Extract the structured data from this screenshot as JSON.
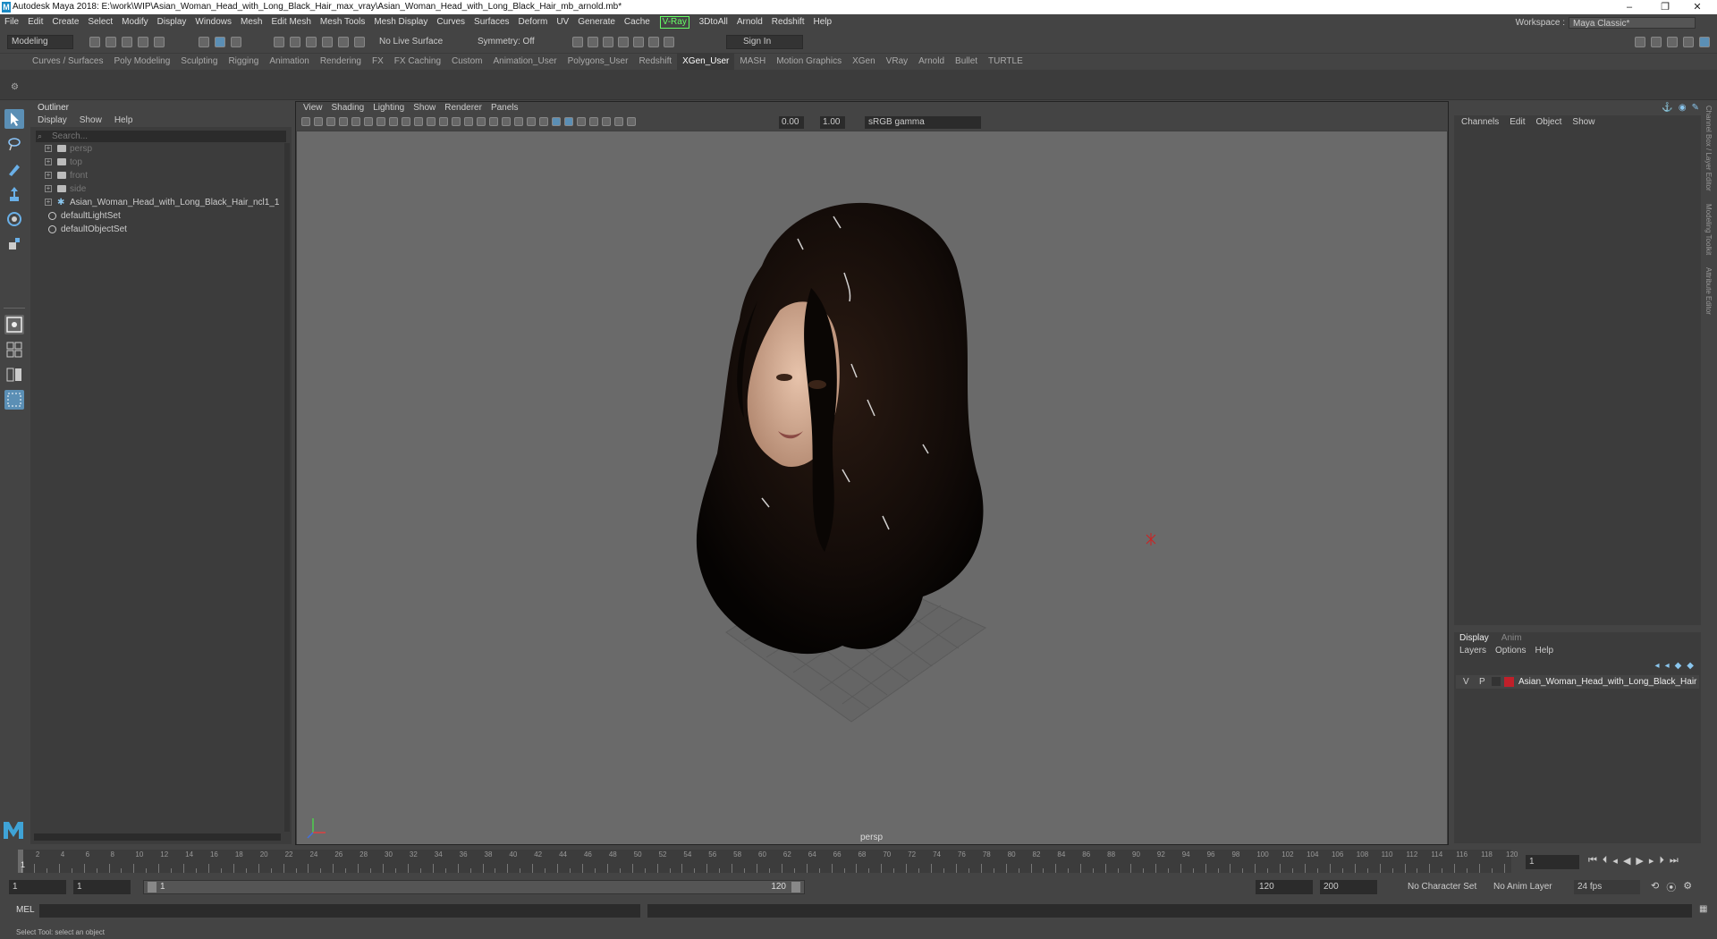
{
  "title": "Autodesk Maya 2018: E:\\work\\WIP\\Asian_Woman_Head_with_Long_Black_Hair_max_vray\\Asian_Woman_Head_with_Long_Black_Hair_mb_arnold.mb*",
  "logo_letter": "M",
  "menus": [
    "File",
    "Edit",
    "Create",
    "Select",
    "Modify",
    "Display",
    "Windows",
    "Mesh",
    "Edit Mesh",
    "Mesh Tools",
    "Mesh Display",
    "Curves",
    "Surfaces",
    "Deform",
    "UV",
    "Generate",
    "Cache"
  ],
  "vray_menu": "V-Ray",
  "menus_after": [
    "3DtoAll",
    "Arnold",
    "Redshift",
    "Help"
  ],
  "workspace": {
    "label": "Workspace :",
    "value": "Maya Classic*"
  },
  "status": {
    "mode": "Modeling",
    "live_surface": "No Live Surface",
    "symmetry": "Symmetry: Off",
    "sign_in": "Sign In"
  },
  "shelf_tabs": [
    "Curves / Surfaces",
    "Poly Modeling",
    "Sculpting",
    "Rigging",
    "Animation",
    "Rendering",
    "FX",
    "FX Caching",
    "Custom",
    "Animation_User",
    "Polygons_User",
    "Redshift",
    "XGen_User",
    "MASH",
    "Motion Graphics",
    "XGen",
    "VRay",
    "Arnold",
    "Bullet",
    "TURTLE"
  ],
  "active_shelf": "XGen_User",
  "outliner": {
    "title": "Outliner",
    "menu": [
      "Display",
      "Show",
      "Help"
    ],
    "search_placeholder": "Search...",
    "items": [
      {
        "label": "persp",
        "dim": true
      },
      {
        "label": "top",
        "dim": true
      },
      {
        "label": "front",
        "dim": true
      },
      {
        "label": "side",
        "dim": true
      },
      {
        "label": "Asian_Woman_Head_with_Long_Black_Hair_ncl1_1",
        "dim": false
      },
      {
        "label": "defaultLightSet",
        "dim": false
      },
      {
        "label": "defaultObjectSet",
        "dim": false
      }
    ]
  },
  "viewport": {
    "menu": [
      "View",
      "Shading",
      "Lighting",
      "Show",
      "Renderer",
      "Panels"
    ],
    "exposure": "0.00",
    "gamma": "1.00",
    "color_space": "sRGB gamma",
    "camera_label": "persp"
  },
  "channel_box": {
    "menu": [
      "Channels",
      "Edit",
      "Object",
      "Show"
    ]
  },
  "layer_editor": {
    "tabs": [
      "Display",
      "Anim"
    ],
    "menu": [
      "Layers",
      "Options",
      "Help"
    ],
    "layer": {
      "v": "V",
      "p": "P",
      "name": "Asian_Woman_Head_with_Long_Black_Hair",
      "color": "#c0202a"
    }
  },
  "side_tabs": [
    "Channel Box / Layer Editor",
    "Modeling Toolkit",
    "Attribute Editor"
  ],
  "timeline": {
    "ticks": [
      "2",
      "4",
      "6",
      "8",
      "10",
      "12",
      "14",
      "16",
      "18",
      "20",
      "22",
      "24",
      "26",
      "28",
      "30",
      "32",
      "34",
      "36",
      "38",
      "40",
      "42",
      "44",
      "46",
      "48",
      "50",
      "52",
      "54",
      "56",
      "58",
      "60",
      "62",
      "64",
      "66",
      "68",
      "70",
      "72",
      "74",
      "76",
      "78",
      "80",
      "82",
      "84",
      "86",
      "88",
      "90",
      "92",
      "94",
      "96",
      "98",
      "100",
      "102",
      "104",
      "106",
      "108",
      "110",
      "112",
      "114",
      "116",
      "118",
      "120"
    ],
    "current_frame_marker": "1",
    "current_frame": "1"
  },
  "range": {
    "start": "1",
    "start2": "1",
    "slider_start": "1",
    "slider_end": "120",
    "end": "120",
    "end2": "200",
    "character_set": "No Character Set",
    "anim_layer": "No Anim Layer",
    "fps": "24 fps"
  },
  "cmdline": {
    "label": "MEL"
  },
  "help_line": "Select Tool: select an object"
}
